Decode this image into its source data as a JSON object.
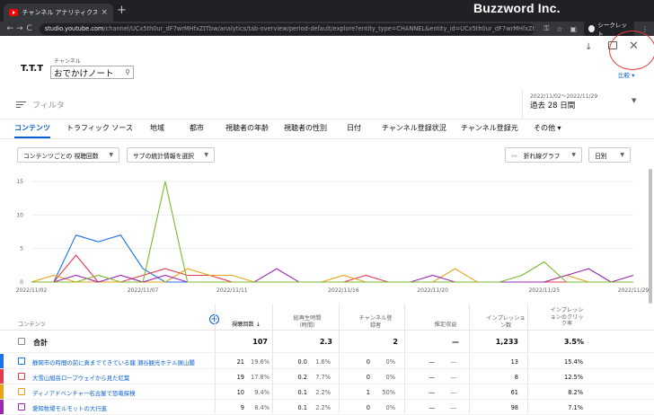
{
  "browser": {
    "tab_title": "チャンネル アナリティクス - YouTube S",
    "tab_close": "×",
    "new_tab": "+",
    "brand_watermark": "Buzzword Inc.",
    "url_host": "studio.youtube.com",
    "url_rest": "/channel/UCx5th0ur_dF7wrMHfxZtTbw/analytics/tab-overview/period-default/explore?entity_type=CHANNEL&entity_id=UCx5th0ur_dF7wrMHfxZtTbw...",
    "incognito_label": "シークレット",
    "nav": {
      "back": "←",
      "forward": "→",
      "reload": "C",
      "lock": "🔒",
      "menu": "⋮"
    }
  },
  "header": {
    "channel_logo": "T.T.T",
    "channel_caption": "チャンネル",
    "channel_name": "おでかけノート",
    "search_icon": "search-icon",
    "download_icon": "↓",
    "close_icon": "✕",
    "compare_link": "比較 ▾"
  },
  "filter": {
    "label": "フィルタ",
    "date_range": "2022/11/02～2022/11/29",
    "date_label": "過去 28 日間"
  },
  "tabs": [
    {
      "label": "コンテンツ",
      "active": true
    },
    {
      "label": "トラフィック ソース"
    },
    {
      "label": "地域"
    },
    {
      "label": "都市"
    },
    {
      "label": "視聴者の年齢"
    },
    {
      "label": "視聴者の性別"
    },
    {
      "label": "日付"
    },
    {
      "label": "チャンネル登録状況"
    },
    {
      "label": "チャンネル登録元"
    },
    {
      "label": "その他 ▾"
    }
  ],
  "controls": {
    "metric_select": "コンテンツごとの 視聴回数",
    "secondary_select": "サブの統計情報を選択",
    "chart_type_select": "折れ線グラフ",
    "granularity_select": "日別"
  },
  "chart_data": {
    "type": "line",
    "x": [
      "2022/11/02",
      "2022/11/03",
      "2022/11/04",
      "2022/11/05",
      "2022/11/06",
      "2022/11/07",
      "2022/11/08",
      "2022/11/09",
      "2022/11/10",
      "2022/11/11",
      "2022/11/12",
      "2022/11/13",
      "2022/11/14",
      "2022/11/15",
      "2022/11/16",
      "2022/11/17",
      "2022/11/18",
      "2022/11/19",
      "2022/11/20",
      "2022/11/21",
      "2022/11/22",
      "2022/11/23",
      "2022/11/24",
      "2022/11/25",
      "2022/11/26",
      "2022/11/27",
      "2022/11/28",
      "2022/11/29"
    ],
    "x_tick_labels": [
      "2022/11/02",
      "2022/11/07",
      "2022/11/11",
      "2022/11/16",
      "2022/11/20",
      "2022/11/25",
      "2022/11/29"
    ],
    "x_tick_index": [
      0,
      5,
      9,
      14,
      18,
      23,
      27
    ],
    "ylim": [
      0,
      15
    ],
    "yticks": [
      0,
      5,
      10,
      15
    ],
    "grid": true,
    "series": [
      {
        "color": "#1a73e8",
        "values": [
          0,
          0,
          7,
          6,
          7,
          2,
          0,
          0,
          0,
          0,
          0,
          0,
          0,
          0,
          0,
          0,
          0,
          0,
          0,
          0,
          0,
          0,
          0,
          0,
          0,
          0,
          0,
          0
        ]
      },
      {
        "color": "#e53950",
        "values": [
          0,
          0,
          4,
          0,
          0,
          1,
          2,
          1,
          1,
          0,
          0,
          0,
          0,
          0,
          0,
          1,
          0,
          0,
          0,
          0,
          0,
          0,
          0,
          0,
          0,
          0,
          0,
          0
        ]
      },
      {
        "color": "#e8a317",
        "values": [
          0,
          1,
          0,
          0,
          0,
          0,
          0,
          2,
          1,
          1,
          0,
          0,
          0,
          0,
          1,
          0,
          0,
          0,
          0,
          2,
          0,
          0,
          0,
          0,
          1,
          0,
          0,
          0
        ]
      },
      {
        "color": "#9c27b0",
        "values": [
          0,
          0,
          1,
          0,
          1,
          0,
          1,
          0,
          0,
          0,
          0,
          2,
          0,
          0,
          0,
          0,
          0,
          0,
          1,
          0,
          0,
          0,
          0,
          0,
          1,
          2,
          0,
          1
        ]
      },
      {
        "color": "#7cb82f",
        "values": [
          0,
          0,
          0,
          1,
          0,
          0,
          15,
          0,
          0,
          0,
          0,
          0,
          0,
          0,
          0,
          0,
          0,
          0,
          0,
          0,
          0,
          0,
          1,
          3,
          0,
          0,
          0,
          0
        ]
      }
    ]
  },
  "table": {
    "add_column_icon": "+",
    "headers": {
      "content": "コンテンツ",
      "views": "視聴回数",
      "watch_time": "総再生時間\n（時間）",
      "subscribers": "チャンネル登\n録者",
      "revenue": "推定収益",
      "impressions": "インプレッショ\nン数",
      "ctr": "インプレッシ\nョンのクリッ\nク率"
    },
    "sort_arrow": "↓",
    "total": {
      "label": "合計",
      "views": "107",
      "watch_time": "2.3",
      "subscribers": "2",
      "revenue": "—",
      "impressions": "1,233",
      "ctr": "3.5%"
    },
    "rows": [
      {
        "title": "静岡市の時間の前に真までてきている龍 潮谷観光ホテル展山閣",
        "color": "#1a73e8",
        "views": "21",
        "views_pct": "19.6%",
        "wt": "0.0",
        "wt_pct": "1.6%",
        "subs": "0",
        "subs_pct": "0%",
        "rev": "—",
        "rev_pct": "—",
        "imp": "13",
        "ctr": "15.4%"
      },
      {
        "title": "大雪山旭岳ロープウェイから見た紅葉",
        "color": "#e53950",
        "views": "19",
        "views_pct": "17.8%",
        "wt": "0.2",
        "wt_pct": "7.7%",
        "subs": "0",
        "subs_pct": "0%",
        "rev": "—",
        "rev_pct": "—",
        "imp": "8",
        "ctr": "12.5%"
      },
      {
        "title": "ディノアドベンチャー名古屋で恐竜探検",
        "color": "#e8a317",
        "views": "10",
        "views_pct": "9.4%",
        "wt": "0.1",
        "wt_pct": "2.2%",
        "subs": "1",
        "subs_pct": "50%",
        "rev": "—",
        "rev_pct": "—",
        "imp": "61",
        "ctr": "8.2%"
      },
      {
        "title": "愛知牧場モルモットの大行進",
        "color": "#9c27b0",
        "views": "9",
        "views_pct": "8.4%",
        "wt": "0.1",
        "wt_pct": "2.2%",
        "subs": "0",
        "subs_pct": "0%",
        "rev": "—",
        "rev_pct": "—",
        "imp": "98",
        "ctr": "7.1%"
      }
    ]
  }
}
